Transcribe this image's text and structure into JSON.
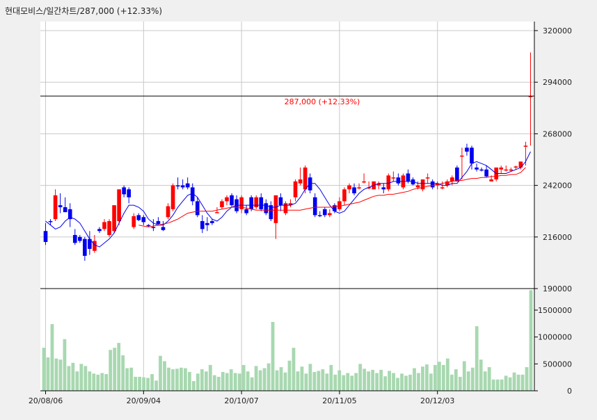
{
  "header": {
    "stock_name": "현대모비스",
    "chart_kind": "일간차트",
    "price": "287,000",
    "change": "(+12.33%)"
  },
  "colors": {
    "up": "#ff0000",
    "down": "#0000ee",
    "ma_short": "#0000ee",
    "ma_long": "#ff0000",
    "volume": "#a8d8b0",
    "grid": "#c8c8c8",
    "price_line_label": "#ff0000"
  },
  "chart_data": [
    {
      "type": "candlestick",
      "title": "",
      "xlabel": "",
      "ylabel": "",
      "ylim": [
        190000,
        320000
      ],
      "yticks": [
        320000,
        294000,
        268000,
        242000,
        216000,
        190000
      ],
      "ytick_labels": [
        "320000",
        "294000",
        "268000",
        "242000",
        "216000",
        "190000"
      ],
      "xticks": [
        "20/08/06",
        "20/09/04",
        "20/10/07",
        "20/11/05",
        "20/12/03"
      ],
      "xtick_index": [
        0,
        20,
        40,
        60,
        80
      ],
      "grid": true,
      "current_price_line": 287000,
      "current_price_label": "287,000 (+12.33%)",
      "ohlc": [
        [
          219000,
          223000,
          212000,
          213500
        ],
        [
          224000,
          225000,
          222000,
          223500
        ],
        [
          225000,
          240000,
          224000,
          237000
        ],
        [
          232000,
          238000,
          228000,
          231000
        ],
        [
          231000,
          236000,
          229000,
          228500
        ],
        [
          230000,
          233000,
          221000,
          225000
        ],
        [
          217000,
          220000,
          212000,
          213000
        ],
        [
          216000,
          217000,
          213000,
          214000
        ],
        [
          215000,
          216000,
          204000,
          206500
        ],
        [
          215000,
          219000,
          207000,
          210000
        ],
        [
          209000,
          217000,
          208000,
          214000
        ],
        [
          220000,
          221000,
          218000,
          219000
        ],
        [
          220000,
          225000,
          219000,
          223500
        ],
        [
          217000,
          225000,
          216000,
          224000
        ],
        [
          219000,
          232000,
          218000,
          232000
        ],
        [
          224000,
          240000,
          222000,
          240000
        ],
        [
          241000,
          242000,
          236000,
          237500
        ],
        [
          240000,
          241000,
          233000,
          236000
        ],
        [
          221000,
          228000,
          220000,
          226500
        ],
        [
          227000,
          228000,
          224000,
          224500
        ],
        [
          226000,
          227000,
          222000,
          223500
        ],
        [
          222000,
          222500,
          221000,
          221500
        ],
        [
          221000,
          225000,
          219000,
          220500
        ],
        [
          224000,
          226000,
          222000,
          222500
        ],
        [
          221000,
          224000,
          219000,
          219500
        ],
        [
          226000,
          233000,
          225000,
          231500
        ],
        [
          230000,
          243000,
          229000,
          242000
        ],
        [
          242000,
          246000,
          240000,
          241500
        ],
        [
          242000,
          245000,
          240000,
          241000
        ],
        [
          243000,
          246000,
          240000,
          241000
        ],
        [
          241000,
          243000,
          232000,
          234000
        ],
        [
          234000,
          236000,
          226000,
          227000
        ],
        [
          224000,
          227000,
          218000,
          220000
        ],
        [
          223000,
          226000,
          219000,
          222000
        ],
        [
          224000,
          225000,
          222000,
          223000
        ],
        [
          228000,
          231000,
          228000,
          228500
        ],
        [
          231000,
          235000,
          230000,
          234000
        ],
        [
          234000,
          237000,
          232000,
          236000
        ],
        [
          237000,
          238000,
          231000,
          232000
        ],
        [
          235000,
          237000,
          228000,
          229000
        ],
        [
          230000,
          237000,
          228000,
          236000
        ],
        [
          230000,
          232000,
          227000,
          228000
        ],
        [
          236000,
          237000,
          229000,
          230000
        ],
        [
          231000,
          237000,
          230000,
          236000
        ],
        [
          236000,
          238000,
          229000,
          230000
        ],
        [
          233000,
          235000,
          227000,
          228000
        ],
        [
          232000,
          234000,
          224000,
          225000
        ],
        [
          223000,
          237000,
          215000,
          237000
        ],
        [
          236000,
          238000,
          229000,
          232000
        ],
        [
          228000,
          234000,
          227000,
          233000
        ],
        [
          232000,
          235000,
          231000,
          233000
        ],
        [
          236000,
          245000,
          234000,
          244000
        ],
        [
          243000,
          251000,
          242000,
          245000
        ],
        [
          240000,
          252000,
          238000,
          251000
        ],
        [
          246000,
          248000,
          238000,
          239500
        ],
        [
          236000,
          238000,
          226000,
          227000
        ],
        [
          227000,
          229000,
          226000,
          226500
        ],
        [
          230000,
          231000,
          226000,
          227000
        ],
        [
          227000,
          230000,
          226000,
          228000
        ],
        [
          232000,
          233000,
          228000,
          229000
        ],
        [
          230000,
          236000,
          229000,
          234000
        ],
        [
          234000,
          241000,
          232000,
          240000
        ],
        [
          240000,
          243000,
          238000,
          242000
        ],
        [
          241000,
          243000,
          237000,
          238000
        ],
        [
          241000,
          243000,
          240000,
          241000
        ],
        [
          244000,
          248000,
          243000,
          244000
        ],
        [
          241000,
          244000,
          240000,
          241000
        ],
        [
          240000,
          244000,
          240000,
          244000
        ],
        [
          242000,
          244000,
          240000,
          243000
        ],
        [
          241000,
          243000,
          238000,
          240000
        ],
        [
          240000,
          248000,
          239000,
          247000
        ],
        [
          246000,
          249000,
          244000,
          246000
        ],
        [
          246000,
          248000,
          242000,
          243000
        ],
        [
          241000,
          248000,
          240000,
          247000
        ],
        [
          248000,
          250000,
          243000,
          244000
        ],
        [
          245000,
          246000,
          242000,
          242500
        ],
        [
          241000,
          244000,
          240000,
          242000
        ],
        [
          240000,
          245000,
          239000,
          245000
        ],
        [
          246000,
          248000,
          243000,
          246000
        ],
        [
          244000,
          245000,
          240000,
          241000
        ],
        [
          242000,
          244000,
          240000,
          243000
        ],
        [
          241000,
          244000,
          240000,
          241000
        ],
        [
          242000,
          245000,
          241000,
          244000
        ],
        [
          244000,
          247000,
          242000,
          246000
        ],
        [
          251000,
          252000,
          244000,
          244000
        ],
        [
          257000,
          261000,
          245000,
          257000
        ],
        [
          261000,
          263000,
          257000,
          259000
        ],
        [
          261000,
          262000,
          250000,
          253000
        ],
        [
          251000,
          253000,
          249000,
          250000
        ],
        [
          250000,
          251000,
          249000,
          249500
        ],
        [
          250000,
          252000,
          246000,
          246500
        ],
        [
          244000,
          247000,
          244000,
          245000
        ],
        [
          245000,
          251000,
          244000,
          251000
        ],
        [
          250000,
          252000,
          248000,
          251000
        ],
        [
          250000,
          252000,
          249000,
          250000
        ],
        [
          250000,
          251000,
          249000,
          250000
        ],
        [
          251000,
          252000,
          250000,
          251500
        ],
        [
          251000,
          254000,
          250000,
          254000
        ],
        [
          262000,
          264000,
          252000,
          262000
        ],
        [
          287000,
          309000,
          262000,
          287000
        ]
      ],
      "ma_short": [
        224000,
        222000,
        220000,
        221000,
        224000,
        226000,
        225000,
        223000,
        219000,
        215000,
        212000,
        211000,
        213000,
        215000,
        218000,
        223000,
        228000,
        232000,
        232000,
        231000,
        229000,
        225000,
        223000,
        222000,
        222000,
        224000,
        227000,
        231000,
        234000,
        237000,
        238000,
        236000,
        232000,
        228000,
        225000,
        224000,
        226000,
        229000,
        231000,
        232000,
        232000,
        232000,
        232000,
        232000,
        232000,
        232000,
        231000,
        231000,
        232000,
        232000,
        232000,
        233000,
        236000,
        240000,
        243000,
        243000,
        240000,
        236000,
        232000,
        229000,
        228000,
        229000,
        232000,
        235000,
        238000,
        240000,
        241000,
        242000,
        243000,
        243000,
        243000,
        244000,
        244000,
        244000,
        244000,
        244000,
        243000,
        243000,
        243000,
        243000,
        243000,
        242000,
        242000,
        243000,
        243000,
        246000,
        249000,
        253000,
        254000,
        253000,
        252000,
        250000,
        248000,
        248000,
        248000,
        249000,
        250000,
        251000,
        254000,
        259000
      ],
      "ma_long": [
        null,
        null,
        null,
        null,
        null,
        null,
        null,
        null,
        null,
        null,
        null,
        null,
        null,
        null,
        null,
        null,
        null,
        null,
        null,
        222000,
        221500,
        221000,
        221500,
        222000,
        222500,
        223000,
        224000,
        225000,
        226500,
        228000,
        228500,
        229000,
        229000,
        229000,
        229000,
        229500,
        230000,
        230500,
        231000,
        231000,
        231000,
        230500,
        230000,
        229500,
        229500,
        229500,
        229500,
        229500,
        229500,
        229500,
        229500,
        229500,
        229500,
        230000,
        230500,
        231000,
        231000,
        231000,
        231000,
        231500,
        231500,
        232000,
        232500,
        233000,
        233500,
        234500,
        235500,
        236500,
        237000,
        237000,
        237500,
        237500,
        238000,
        238500,
        239000,
        240000,
        240500,
        241000,
        241500,
        242000,
        242500,
        243000,
        243500,
        244000,
        244500,
        244500,
        245000,
        245500,
        245500,
        246000,
        246000,
        246500,
        246500,
        247000,
        247000,
        247500,
        247500,
        248500,
        251000
      ]
    },
    {
      "type": "bar",
      "title": "",
      "ylim": [
        0,
        1900000
      ],
      "yticks": [
        0,
        500000,
        1000000,
        1500000
      ],
      "ytick_labels": [
        "0",
        "500000",
        "1000000",
        "1500000"
      ],
      "values": [
        800000,
        620000,
        1240000,
        600000,
        580000,
        960000,
        460000,
        520000,
        360000,
        500000,
        460000,
        360000,
        320000,
        300000,
        330000,
        310000,
        760000,
        800000,
        890000,
        660000,
        420000,
        430000,
        260000,
        260000,
        250000,
        240000,
        310000,
        190000,
        650000,
        550000,
        430000,
        400000,
        410000,
        430000,
        420000,
        350000,
        180000,
        320000,
        400000,
        360000,
        480000,
        290000,
        260000,
        350000,
        330000,
        400000,
        330000,
        320000,
        480000,
        360000,
        250000,
        460000,
        380000,
        420000,
        510000,
        1280000,
        380000,
        440000,
        340000,
        560000,
        800000,
        360000,
        450000,
        320000,
        500000,
        350000,
        370000,
        400000,
        320000,
        480000,
        300000,
        380000,
        290000,
        330000,
        280000,
        330000,
        500000,
        410000,
        360000,
        390000,
        330000,
        390000,
        270000,
        370000,
        330000,
        240000,
        320000,
        280000,
        300000,
        420000,
        330000,
        450000,
        490000,
        320000,
        480000,
        540000,
        480000,
        600000,
        300000,
        400000,
        260000,
        550000,
        360000,
        430000,
        1200000,
        580000,
        360000,
        440000,
        210000,
        210000,
        210000,
        280000,
        250000,
        340000,
        300000,
        300000,
        440000,
        1870000
      ]
    }
  ]
}
